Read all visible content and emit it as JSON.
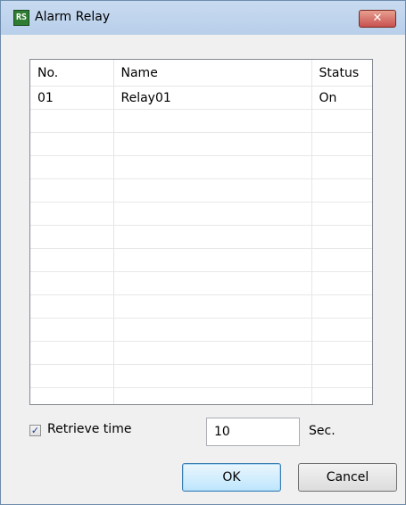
{
  "window": {
    "title": "Alarm Relay",
    "icon_text": "RS",
    "close_label": "✕"
  },
  "table": {
    "columns": [
      "No.",
      "Name",
      "Status"
    ],
    "rows": [
      [
        "01",
        "Relay01",
        "On"
      ],
      [
        "",
        "",
        ""
      ],
      [
        "",
        "",
        ""
      ],
      [
        "",
        "",
        ""
      ],
      [
        "",
        "",
        ""
      ],
      [
        "",
        "",
        ""
      ],
      [
        "",
        "",
        ""
      ],
      [
        "",
        "",
        ""
      ],
      [
        "",
        "",
        ""
      ],
      [
        "",
        "",
        ""
      ],
      [
        "",
        "",
        ""
      ],
      [
        "",
        "",
        ""
      ],
      [
        "",
        "",
        ""
      ],
      [
        "",
        "",
        ""
      ]
    ]
  },
  "retrieve": {
    "checked": true,
    "check_glyph": "✓",
    "label": "Retrieve time",
    "value": "10",
    "unit": "Sec."
  },
  "buttons": {
    "ok": "OK",
    "cancel": "Cancel"
  }
}
